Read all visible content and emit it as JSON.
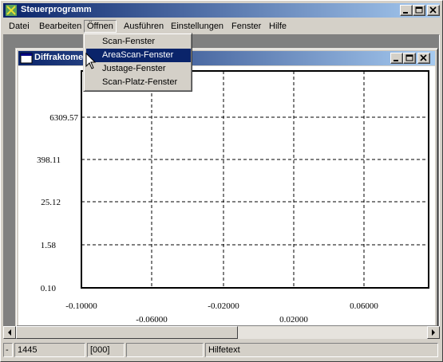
{
  "app": {
    "title": "Steuerprogramm",
    "accent": "#0a246a"
  },
  "menu": {
    "items": [
      {
        "label": "Datei"
      },
      {
        "label": "Bearbeiten"
      },
      {
        "label": "Öffnen"
      },
      {
        "label": "Ausführen"
      },
      {
        "label": "Einstellungen"
      },
      {
        "label": "Fenster"
      },
      {
        "label": "Hilfe"
      }
    ],
    "open_index": 2,
    "dropdown": [
      {
        "label": "Scan-Fenster"
      },
      {
        "label": "AreaScan-Fenster"
      },
      {
        "label": "Justage-Fenster"
      },
      {
        "label": "Scan-Platz-Fenster"
      }
    ],
    "highlighted_index": 1
  },
  "child_window": {
    "title": "Diffraktometer"
  },
  "plot": {
    "y_ticks": [
      "6309.57",
      "398.11",
      "25.12",
      "1.58",
      "0.10"
    ],
    "x_ticks_upper": [
      "-0.10000",
      "-0.02000",
      "0.06000"
    ],
    "x_ticks_lower": [
      "-0.06000",
      "0.02000"
    ],
    "grid": "dashed",
    "y_scale": "log"
  },
  "status": {
    "cell0": "-",
    "cell1": "1445",
    "cell2": "[000]",
    "cell3": "",
    "cell4": "Hilfetext"
  },
  "icons": {
    "app": "app-icon",
    "doc": "document-icon",
    "minimize": "minimize-icon",
    "maximize": "maximize-icon",
    "close": "close-icon",
    "scroll_left": "arrow-left-icon",
    "scroll_right": "arrow-right-icon",
    "cursor": "mouse-pointer-icon"
  }
}
